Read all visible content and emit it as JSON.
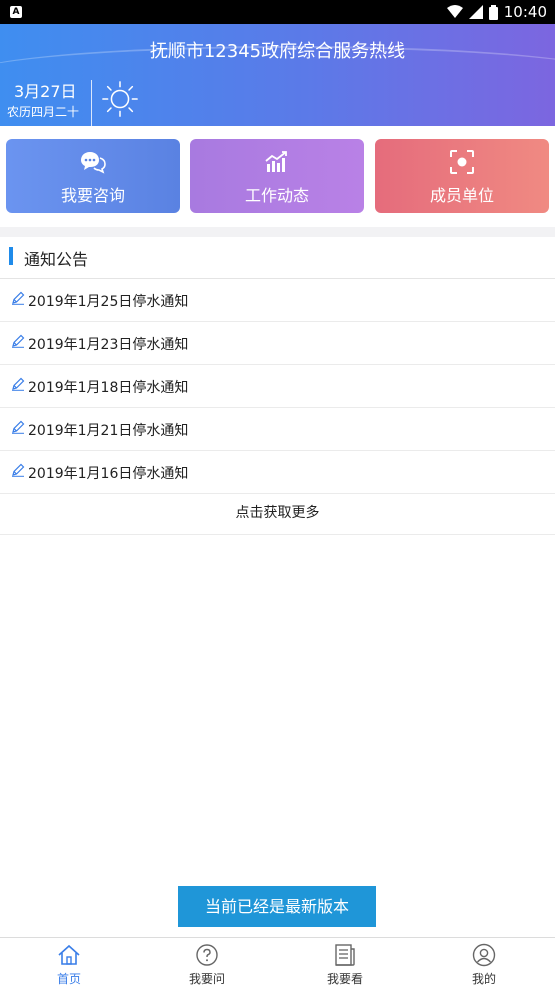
{
  "status_bar": {
    "time": "10:40"
  },
  "header": {
    "title": "抚顺市12345政府综合服务热线",
    "date": "3月27日",
    "lunar_date": "农历四月二十",
    "weather_icon": "sun-icon",
    "gradient": [
      "#3f8ef0",
      "#7c66e0"
    ]
  },
  "tiles": [
    {
      "label": "我要咨询",
      "icon": "chat-bubbles-icon",
      "color": "#5a82e2"
    },
    {
      "label": "工作动态",
      "icon": "trend-chart-icon",
      "color": "#b981e6"
    },
    {
      "label": "成员单位",
      "icon": "focus-target-icon",
      "color": "#e56c7c"
    }
  ],
  "notices": {
    "title": "通知公告",
    "items": [
      "2019年1月25日停水通知",
      "2019年1月23日停水通知",
      "2019年1月18日停水通知",
      "2019年1月21日停水通知",
      "2019年1月16日停水通知"
    ],
    "more_label": "点击获取更多"
  },
  "toast": "当前已经是最新版本",
  "tabbar": {
    "active_index": 0,
    "active_color": "#3a7ee8",
    "items": [
      {
        "label": "首页",
        "icon": "home-icon"
      },
      {
        "label": "我要问",
        "icon": "question-icon"
      },
      {
        "label": "我要看",
        "icon": "news-icon"
      },
      {
        "label": "我的",
        "icon": "user-icon"
      }
    ]
  }
}
